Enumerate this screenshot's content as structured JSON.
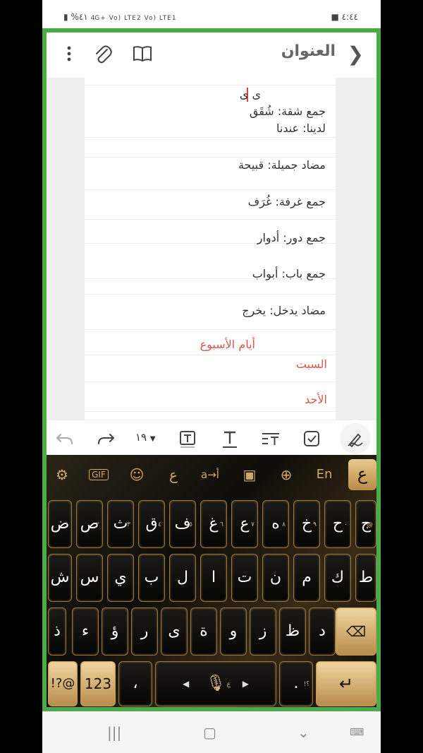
{
  "status": {
    "time": "٤:٤٤",
    "battery": "%٤١",
    "network": "4G+ Vo) LTE2 Vo) LTE1"
  },
  "toolbar": {
    "title": "العنوان"
  },
  "note": {
    "lines": [
      {
        "text": "ى ى",
        "color": "normal"
      },
      {
        "text": "جمع شقة: شُقَق",
        "color": "normal"
      },
      {
        "text": "لدينا: عندنا",
        "color": "normal"
      },
      {
        "text": "مضاد جميلة: قبيحة",
        "color": "normal"
      },
      {
        "text": "جمع غرفة: غُرَف",
        "color": "normal"
      },
      {
        "text": "جمع دور: أدوار",
        "color": "normal"
      },
      {
        "text": "جمع باب: أبواب",
        "color": "normal"
      },
      {
        "text": "مضاد يدخل: يخرج",
        "color": "normal"
      },
      {
        "text": "أيام الأسبوع",
        "color": "red"
      },
      {
        "text": "السبت",
        "color": "red"
      },
      {
        "text": "الأحد",
        "color": "red"
      }
    ]
  },
  "format": {
    "font_size": "١٩"
  },
  "keyboard": {
    "lang_key": "ع",
    "top": {
      "gif": "GIF",
      "translit": "a→أ",
      "en": "En"
    },
    "row1": [
      "ض",
      "ص",
      "ث",
      "ق",
      "ف",
      "غ",
      "ع",
      "ه",
      "خ",
      "ح",
      "ج"
    ],
    "row1_hints": [
      "١",
      "٢",
      "٣",
      "٤",
      "٥",
      "٦",
      "٧",
      "٨",
      "٩",
      "٠",
      "@"
    ],
    "row2": [
      "ش",
      "س",
      "ي",
      "ب",
      "ل",
      "ا",
      "ت",
      "ن",
      "م",
      "ك",
      "ط"
    ],
    "row3": [
      "ذ",
      "ء",
      "ؤ",
      "ر",
      "ى",
      "ة",
      "و",
      "ز",
      "ظ",
      "د"
    ],
    "symbols": "!?@",
    "numbers": "123",
    "comma": "،",
    "space_hint": "ع",
    "period": ".",
    "period_hint": "!؟"
  }
}
